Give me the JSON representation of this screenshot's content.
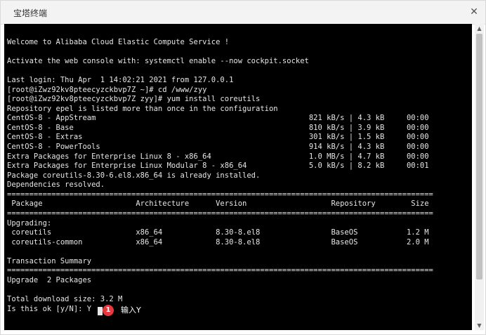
{
  "window": {
    "title": "宝塔终端",
    "close_glyph": "✕"
  },
  "terminal": {
    "lines": [
      "",
      "Welcome to Alibaba Cloud Elastic Compute Service !",
      "",
      "Activate the web console with: systemctl enable --now cockpit.socket",
      "",
      "Last login: Thu Apr  1 14:02:21 2021 from 127.0.0.1",
      "[root@iZwz92kv8pteecyzckbvp7Z ~]# cd /www/zyy",
      "[root@iZwz92kv8pteecyzckbvp7Z zyy]# yum install coreutils",
      "Repository epel is listed more than once in the configuration",
      "CentOS-8 - AppStream                                                821 kB/s | 4.3 kB     00:00",
      "CentOS-8 - Base                                                     810 kB/s | 3.9 kB     00:00",
      "CentOS-8 - Extras                                                   301 kB/s | 1.5 kB     00:00",
      "CentOS-8 - PowerTools                                               914 kB/s | 4.3 kB     00:00",
      "Extra Packages for Enterprise Linux 8 - x86_64                      1.0 MB/s | 4.7 kB     00:00",
      "Extra Packages for Enterprise Linux Modular 8 - x86_64              5.0 kB/s | 8.2 kB     00:01",
      "Package coreutils-8.30-6.el8.x86_64 is already installed.",
      "Dependencies resolved.",
      "================================================================================================",
      " Package                     Architecture      Version                   Repository        Size",
      "================================================================================================",
      "Upgrading:",
      " coreutils                   x86_64            8.30-8.el8                BaseOS           1.2 M",
      " coreutils-common            x86_64            8.30-8.el8                BaseOS           2.0 M",
      "",
      "Transaction Summary",
      "================================================================================================",
      "Upgrade  2 Packages",
      "",
      "Total download size: 3.2 M",
      "Is this ok [y/N]: Y"
    ]
  },
  "annotation": {
    "badge_number": "1",
    "text": "输入Y"
  },
  "scrollbar": {
    "up_glyph": "▲",
    "down_glyph": "▼"
  }
}
